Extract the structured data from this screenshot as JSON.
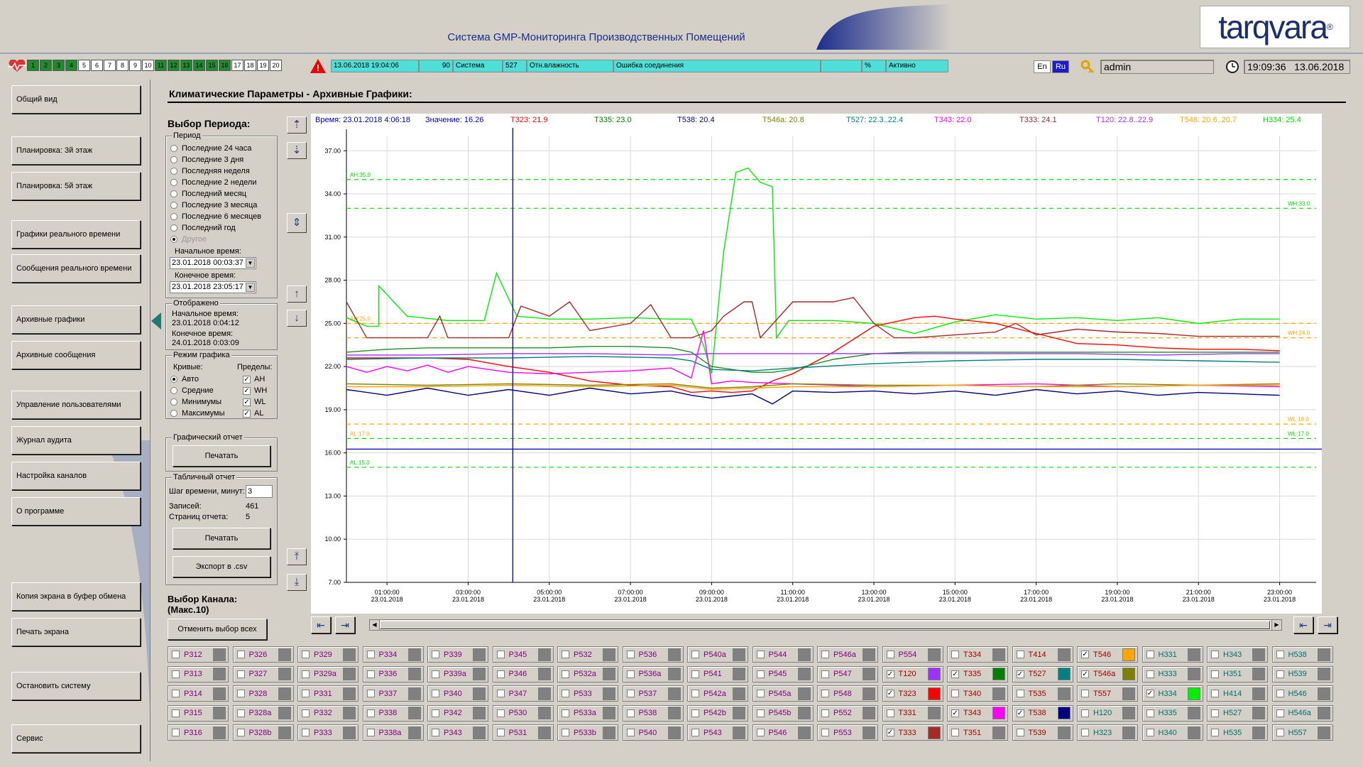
{
  "header": {
    "title": "Система GMP-Мониторинга Производственных Помещений",
    "logo": "tarqvara"
  },
  "status": {
    "levels": [
      "1",
      "2",
      "3",
      "4",
      "5",
      "6",
      "7",
      "8",
      "9",
      "10",
      "11",
      "12",
      "13",
      "14",
      "15",
      "16",
      "17",
      "18",
      "19",
      "20"
    ],
    "active": [
      1,
      2,
      3,
      4,
      11,
      12,
      13,
      14,
      15,
      16
    ],
    "date": "13.06.2018 19:04:06",
    "code": "90",
    "source": "Система",
    "sensor": "527",
    "param": "Отн.влажность",
    "message": "Ошибка соединения",
    "blank": "",
    "unit": "%",
    "state": "Активно",
    "lang_en": "En",
    "lang_ru": "Ru",
    "user": "admin",
    "clock": "19:09:36   13.06.2018"
  },
  "nav": [
    "Общий вид",
    "Планировка: 3й этаж",
    "Планировка: 5й этаж",
    "Графики реального времени",
    "Сообщения реального времени",
    "Архивные графики",
    "Архивные сообщения",
    "Управление пользователями",
    "Журнал аудита",
    "Настройка каналов",
    "О программе",
    "Копия экрана в буфер обмена",
    "Печать экрана",
    "Остановить систему",
    "Сервис"
  ],
  "page_title": "Климатические Параметры - Архивные Графики:",
  "period": {
    "heading": "Выбор Периода:",
    "group": "Период",
    "options": [
      "Последние 24 часа",
      "Последние 3 дня",
      "Последняя неделя",
      "Последние 2 недели",
      "Последний месяц",
      "Последние 3 месяца",
      "Последние 6 месяцев",
      "Последний год",
      "Другое"
    ],
    "start_label": "Начальное время:",
    "start": "23.01.2018 00:03:37",
    "end_label": "Конечное время:",
    "end": "23.01.2018 23:05:17"
  },
  "shown": {
    "group": "Отображено",
    "start_label": "Начальное время:",
    "start": "23.01.2018 0:04:12",
    "end_label": "Конечное время:",
    "end": "24.01.2018 0:03:09"
  },
  "mode": {
    "group": "Режим графика",
    "curves": "Кривые:",
    "limits": "Пределы:",
    "opts": [
      "Авто",
      "Средние",
      "Минимумы",
      "Максимумы"
    ],
    "lims": [
      "AH",
      "WH",
      "WL",
      "AL"
    ]
  },
  "graph_report": {
    "group": "Графический отчет",
    "print": "Печатать"
  },
  "table_report": {
    "group": "Табличный отчет",
    "step_label": "Шаг времени, минут:",
    "step": "3",
    "records_label": "Записей:",
    "records": "461",
    "pages_label": "Страниц отчета:",
    "pages": "5",
    "print": "Печатать",
    "export": "Экспорт в .csv"
  },
  "channel": {
    "heading": "Выбор Канала:",
    "sub": "(Макс.10)",
    "clear": "Отменить выбор всех"
  },
  "chart_data": {
    "type": "line",
    "header": [
      {
        "t": "Время: 23.01.2018 4:06:18",
        "c": "#0000c0"
      },
      {
        "t": "Значение: 16.26",
        "c": "#0000c0"
      },
      {
        "t": "T323: 21.9",
        "c": "#ff0000"
      },
      {
        "t": "T335: 23.0",
        "c": "#008000"
      },
      {
        "t": "T538: 20.4",
        "c": "#000080"
      },
      {
        "t": "T546a: 20.8",
        "c": "#808000"
      },
      {
        "t": "T527: 22.3..22.4",
        "c": "#008080"
      },
      {
        "t": "T343: 22.0",
        "c": "#ff00ff"
      },
      {
        "t": "T333: 24.1",
        "c": "#a52a2a"
      },
      {
        "t": "T120: 22.8..22.9",
        "c": "#9933ff"
      },
      {
        "t": "T546: 20.6..20.7",
        "c": "#ffa500"
      },
      {
        "t": "H334: 25.4",
        "c": "#00dd00"
      }
    ],
    "ylim": [
      7,
      38
    ],
    "yticks": [
      "7.00",
      "10.00",
      "13.00",
      "16.00",
      "19.00",
      "22.00",
      "25.00",
      "28.00",
      "31.00",
      "34.00",
      "37.00"
    ],
    "xlim": [
      0,
      23.9
    ],
    "xticks": [
      {
        "h": 1,
        "t": "01:00:00",
        "d": "23.01.2018"
      },
      {
        "h": 3,
        "t": "03:00:00",
        "d": "23.01.2018"
      },
      {
        "h": 5,
        "t": "05:00:00",
        "d": "23.01.2018"
      },
      {
        "h": 7,
        "t": "07:00:00",
        "d": "23.01.2018"
      },
      {
        "h": 9,
        "t": "09:00:00",
        "d": "23.01.2018"
      },
      {
        "h": 11,
        "t": "11:00:00",
        "d": "23.01.2018"
      },
      {
        "h": 13,
        "t": "13:00:00",
        "d": "23.01.2018"
      },
      {
        "h": 15,
        "t": "15:00:00",
        "d": "23.01.2018"
      },
      {
        "h": 17,
        "t": "17:00:00",
        "d": "23.01.2018"
      },
      {
        "h": 19,
        "t": "19:00:00",
        "d": "23.01.2018"
      },
      {
        "h": 21,
        "t": "21:00:00",
        "d": "23.01.2018"
      },
      {
        "h": 23,
        "t": "23:00:00",
        "d": "23.01.2018"
      }
    ],
    "limits": [
      {
        "label": "AH:35.0",
        "y": 35,
        "c": "#00dd00",
        "side": "left"
      },
      {
        "label": "WH:33.0",
        "y": 33,
        "c": "#00dd00",
        "side": "right"
      },
      {
        "label": "AH:25.0",
        "y": 25,
        "c": "#ffa500",
        "side": "left"
      },
      {
        "label": "WH:24.0",
        "y": 24,
        "c": "#ffa500",
        "side": "right"
      },
      {
        "label": "WL:18.0",
        "y": 18,
        "c": "#ffa500",
        "side": "right"
      },
      {
        "label": "AL:17.0",
        "y": 17,
        "c": "#ffa500",
        "side": "left"
      },
      {
        "label": "WL:17.0",
        "y": 17,
        "c": "#00dd00",
        "side": "right"
      },
      {
        "label": "AL:15.0",
        "y": 15,
        "c": "#00dd00",
        "side": "left"
      }
    ],
    "cursor": {
      "x": 4.1,
      "y": 16.26
    },
    "series": [
      {
        "name": "H334",
        "color": "#00ee00",
        "x": [
          0,
          0.5,
          0.8,
          0.8,
          1.5,
          2.5,
          3.4,
          3.7,
          4.2,
          5,
          6,
          7,
          8,
          8.5,
          8.8,
          9.0,
          9.3,
          9.6,
          9.9,
          10.2,
          10.5,
          10.6,
          10.9,
          11.5,
          12,
          13,
          14,
          15,
          16,
          17,
          18,
          19,
          20,
          21,
          22,
          23
        ],
        "y": [
          25.4,
          24.8,
          24.8,
          27.6,
          25.5,
          25.2,
          25.2,
          28.5,
          25.5,
          25.3,
          25.3,
          25.4,
          25.3,
          25.3,
          23.5,
          21.5,
          30,
          35.5,
          35.8,
          34.8,
          34.5,
          24.0,
          25.2,
          25.2,
          25.2,
          25.0,
          24.3,
          25.1,
          25.6,
          25.3,
          25.4,
          25.2,
          25.4,
          25.0,
          25.3,
          25.3
        ]
      },
      {
        "name": "T333",
        "color": "#a52a2a",
        "x": [
          0,
          0.3,
          0.5,
          1,
          2,
          2.3,
          2.5,
          3,
          4,
          4.3,
          5,
          5.5,
          6,
          7,
          7.5,
          8,
          8.5,
          9,
          9.3,
          9.8,
          10,
          10.2,
          11,
          12,
          12.5,
          13,
          13.5,
          14,
          15,
          16,
          16.5,
          17,
          18,
          19,
          20,
          21,
          22,
          23
        ],
        "y": [
          26.5,
          25.0,
          24.0,
          24.0,
          24.0,
          25.5,
          24.0,
          24.0,
          24.0,
          26.2,
          25.5,
          26.5,
          24.5,
          25.0,
          26.3,
          24.0,
          24.0,
          24.5,
          25.5,
          26.5,
          26.5,
          24.0,
          26.5,
          26.5,
          26.8,
          25.0,
          24.0,
          24.0,
          24.2,
          24.4,
          25.0,
          24.2,
          24.6,
          24.4,
          24.3,
          24.1,
          24.1,
          24.1
        ]
      },
      {
        "name": "T323",
        "color": "#ff0000",
        "x": [
          0,
          1,
          2,
          3,
          4,
          5,
          6,
          7,
          8,
          8.5,
          9,
          9.5,
          10,
          10.5,
          11,
          12,
          13,
          14,
          14.5,
          15,
          16,
          17,
          18,
          19,
          20,
          21,
          22,
          23
        ],
        "y": [
          22.6,
          22.6,
          22.6,
          22.5,
          22.0,
          21.6,
          21.0,
          20.7,
          20.6,
          20.2,
          20.3,
          20.2,
          20.3,
          21.0,
          21.5,
          23.0,
          24.8,
          25.4,
          25.5,
          25.3,
          25.0,
          24.3,
          23.6,
          23.5,
          23.3,
          23.2,
          23.2,
          23.1
        ]
      },
      {
        "name": "T335",
        "color": "#228b22",
        "x": [
          0,
          1,
          2,
          3,
          4,
          5,
          6,
          7,
          8,
          8.5,
          9,
          9.5,
          10,
          10.5,
          11,
          12,
          13,
          14,
          15,
          16,
          17,
          18,
          19,
          20,
          21,
          22,
          23
        ],
        "y": [
          23.0,
          23.2,
          23.3,
          23.3,
          23.3,
          23.3,
          23.4,
          23.4,
          23.3,
          23.0,
          22.0,
          21.8,
          21.6,
          21.6,
          21.8,
          22.5,
          22.9,
          23.0,
          23.0,
          23.0,
          23.0,
          23.0,
          23.0,
          23.0,
          23.0,
          23.0,
          23.0
        ]
      },
      {
        "name": "T527",
        "color": "#008080",
        "x": [
          0,
          2,
          4,
          6,
          8,
          8.5,
          9,
          10,
          11,
          13,
          15,
          17,
          19,
          21,
          23
        ],
        "y": [
          22.5,
          22.6,
          22.6,
          22.7,
          22.6,
          22.4,
          21.8,
          21.7,
          21.9,
          22.2,
          22.4,
          22.5,
          22.5,
          22.4,
          22.3
        ]
      },
      {
        "name": "T120",
        "color": "#9933ff",
        "x": [
          0,
          2,
          4,
          6,
          8,
          9,
          10,
          12,
          14,
          16,
          18,
          20,
          22,
          23
        ],
        "y": [
          22.8,
          22.8,
          22.9,
          22.9,
          22.8,
          22.9,
          22.9,
          22.9,
          22.9,
          22.9,
          22.9,
          22.8,
          22.9,
          22.9
        ]
      },
      {
        "name": "T343",
        "color": "#ff00ff",
        "x": [
          0,
          0.5,
          1,
          1.5,
          2,
          2.5,
          3,
          3.5,
          4,
          5,
          6,
          7,
          8,
          8.5,
          8.8,
          9,
          9.5,
          10,
          11,
          13,
          15,
          17,
          19,
          21,
          23
        ],
        "y": [
          22.0,
          21.6,
          22.0,
          21.7,
          22.1,
          21.6,
          22.0,
          21.8,
          21.6,
          21.5,
          21.6,
          21.7,
          21.9,
          21.2,
          24.5,
          20.8,
          21.0,
          20.9,
          20.8,
          20.6,
          20.7,
          20.8,
          20.6,
          20.7,
          20.6
        ]
      },
      {
        "name": "T546a",
        "color": "#808000",
        "x": [
          0,
          2,
          4,
          6,
          8,
          9,
          10,
          11,
          13,
          15,
          17,
          19,
          21,
          23
        ],
        "y": [
          20.8,
          20.7,
          20.8,
          20.7,
          20.8,
          20.5,
          20.6,
          20.8,
          20.7,
          20.7,
          20.6,
          20.8,
          20.7,
          20.8
        ]
      },
      {
        "name": "T546",
        "color": "#ffa500",
        "x": [
          0,
          2,
          4,
          6,
          8,
          9,
          10,
          11,
          13,
          15,
          17,
          19,
          21,
          23
        ],
        "y": [
          20.6,
          20.6,
          20.7,
          20.6,
          20.7,
          20.4,
          20.5,
          20.6,
          20.6,
          20.7,
          20.6,
          20.6,
          20.7,
          20.7
        ]
      },
      {
        "name": "T538",
        "color": "#000080",
        "x": [
          0,
          1,
          2,
          3,
          4,
          5,
          6,
          7,
          8,
          8.5,
          9,
          10,
          10.5,
          11,
          12,
          13,
          14,
          15,
          16,
          17,
          18,
          19,
          20,
          21,
          22,
          23
        ],
        "y": [
          20.4,
          20.0,
          20.5,
          20.0,
          20.4,
          20.0,
          20.5,
          20.1,
          20.3,
          20.0,
          19.8,
          20.1,
          19.4,
          20.3,
          20.2,
          20.3,
          20.1,
          20.3,
          20.0,
          20.4,
          20.1,
          20.3,
          20.0,
          20.2,
          20.1,
          20.0
        ]
      }
    ]
  },
  "channels": [
    [
      "P312",
      "P326",
      "P329",
      "P334",
      "P339",
      "P345",
      "P532",
      "P536",
      "P540a",
      "P544",
      "P546a",
      "P554",
      "T334",
      "T414",
      "T546",
      "H331",
      "H343",
      "H538"
    ],
    [
      "P313",
      "P327",
      "P329a",
      "P336",
      "P339a",
      "P346",
      "P532a",
      "P536a",
      "P541",
      "P545",
      "P547",
      "T120",
      "T335",
      "T527",
      "T546a",
      "H333",
      "H351",
      "H539"
    ],
    [
      "P314",
      "P328",
      "P331",
      "P337",
      "P340",
      "P347",
      "P533",
      "P537",
      "P542a",
      "P545a",
      "P548",
      "T323",
      "T340",
      "T535",
      "T557",
      "H334",
      "H414",
      "H546"
    ],
    [
      "P315",
      "P328a",
      "P332",
      "P338",
      "P342",
      "P530",
      "P533a",
      "P538",
      "P542b",
      "P545b",
      "P552",
      "T331",
      "T343",
      "T538",
      "H120",
      "H335",
      "H527",
      "H546a"
    ],
    [
      "P316",
      "P328b",
      "P333",
      "P338a",
      "P343",
      "P531",
      "P533b",
      "P540",
      "P543",
      "P546",
      "P553",
      "T333",
      "T351",
      "T539",
      "H323",
      "H340",
      "H535",
      "H557"
    ]
  ],
  "checked": {
    "T546": "#ffa500",
    "T120": "#9933ff",
    "T335": "#008000",
    "T527": "#008080",
    "T546a": "#808000",
    "T323": "#ff0000",
    "H334": "#00ee00",
    "T343": "#ff00ff",
    "T538": "#000080",
    "T333": "#a52a2a"
  }
}
